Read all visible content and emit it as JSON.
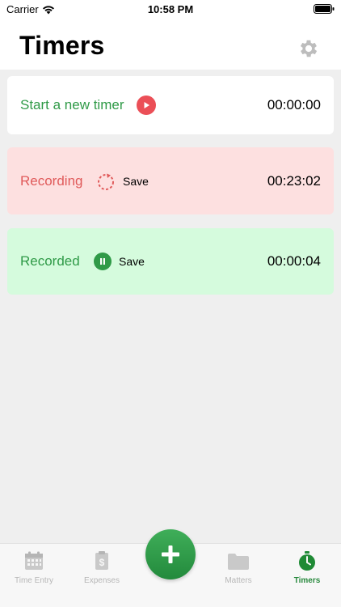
{
  "status_bar": {
    "carrier": "Carrier",
    "time": "10:58 PM"
  },
  "header": {
    "title": "Timers",
    "settings_icon": "gear-icon"
  },
  "timers": {
    "new_timer": {
      "label": "Start a new timer",
      "time": "00:00:00",
      "icon": "play-icon"
    },
    "recording": {
      "label": "Recording",
      "action": "Save",
      "time": "00:23:02",
      "icon": "spinner-icon"
    },
    "recorded": {
      "label": "Recorded",
      "action": "Save",
      "time": "00:00:04",
      "icon": "pause-icon"
    }
  },
  "tabbar": {
    "time_entry": "Time Entry",
    "expenses": "Expenses",
    "add": "plus-icon",
    "matters": "Matters",
    "timers": "Timers",
    "active_tab": "Timers"
  },
  "colors": {
    "accent_green": "#2f9a47",
    "accent_red": "#e05a5a",
    "recording_bg": "#fde0e0",
    "recorded_bg": "#d5fbdd"
  }
}
